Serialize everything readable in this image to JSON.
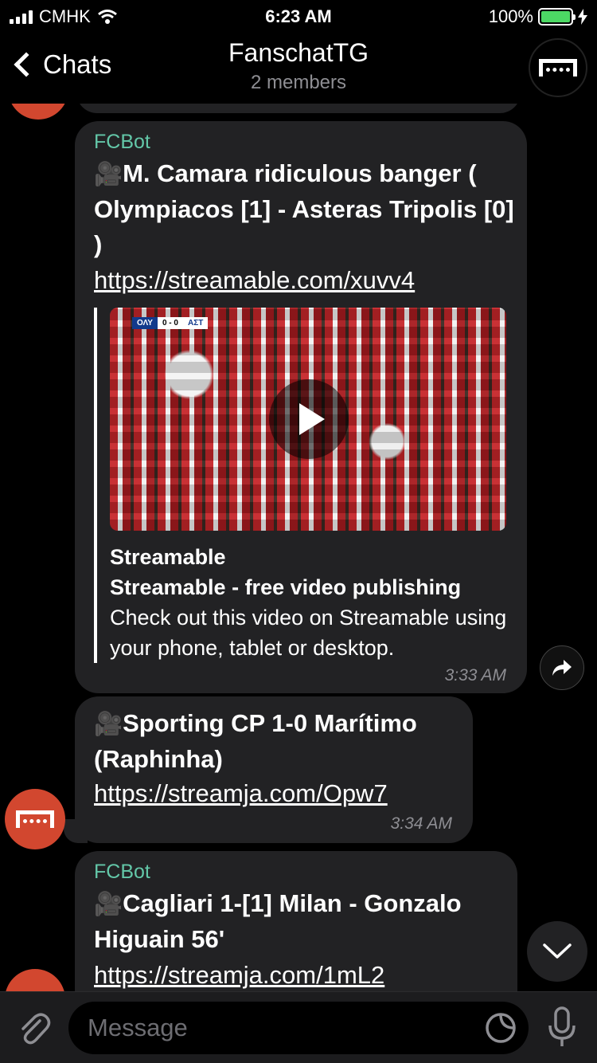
{
  "status_bar": {
    "carrier": "CMHK",
    "time": "6:23 AM",
    "battery": "100%",
    "battery_level": 1.0
  },
  "nav": {
    "back_label": "Chats",
    "title": "FanschatTG",
    "subtitle": "2 members"
  },
  "colors": {
    "sender": "#63c7a8",
    "bubble": "#222224",
    "avatar": "#d2472f",
    "battery": "#4cd964"
  },
  "messages": [
    {
      "sender": "FCBot",
      "icon": "🎥",
      "text": "M. Camara ridiculous banger ( Olympiacos [1] - Asteras Tripolis [0] )",
      "link": "https://streamable.com/xuvv4",
      "preview": {
        "score": [
          "ΟΛΥ",
          "0 - 0",
          "ΑΣΤ"
        ],
        "site": "Streamable",
        "title": "Streamable - free video publishing",
        "description": "Check out this video on Streamable using your phone, tablet or desktop."
      },
      "time": "3:33 AM"
    },
    {
      "icon": "🎥",
      "text": "Sporting CP 1-0 Marítimo (Raphinha)",
      "link": "https://streamja.com/Opw7",
      "time": "3:34 AM"
    },
    {
      "sender": "FCBot",
      "icon": "🎥",
      "text": "Cagliari 1-[1] Milan - Gonzalo Higuain 56'",
      "link": "https://streamja.com/1mL2"
    }
  ],
  "input": {
    "placeholder": "Message"
  }
}
